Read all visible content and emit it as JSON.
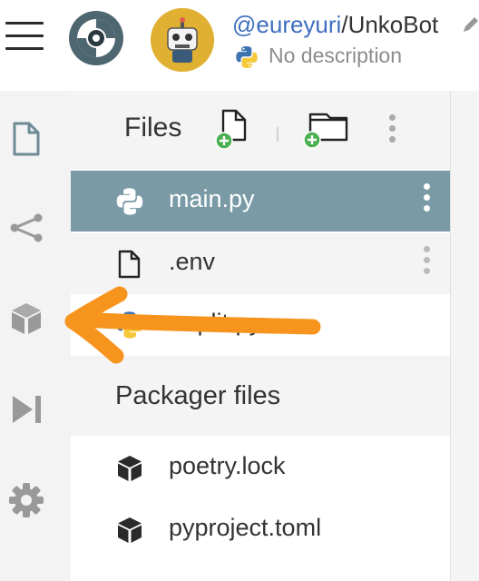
{
  "header": {
    "owner": "@eureyuri",
    "separator": "/",
    "repo": "UnkoBot",
    "description": "No description"
  },
  "sidebar": {
    "items": [
      {
        "name": "files",
        "icon": "file-icon"
      },
      {
        "name": "version-control",
        "icon": "share-nodes-icon"
      },
      {
        "name": "packages",
        "icon": "cube-icon"
      },
      {
        "name": "debugger",
        "icon": "play-step-icon"
      },
      {
        "name": "settings",
        "icon": "gear-icon"
      }
    ]
  },
  "files_panel": {
    "title": "Files",
    "files": [
      {
        "name": "main.py",
        "icon": "python-icon",
        "selected": true
      },
      {
        "name": ".env",
        "icon": "file-icon",
        "selected": false
      },
      {
        "name": ".replit.py",
        "icon": "python-icon",
        "selected": false
      }
    ],
    "packager_title": "Packager files",
    "packager_files": [
      {
        "name": "poetry.lock",
        "icon": "cube-icon"
      },
      {
        "name": "pyproject.toml",
        "icon": "cube-icon"
      }
    ]
  },
  "colors": {
    "selected_row": "#7a9aa6",
    "owner_link": "#3f6fbf",
    "annotation_arrow": "#f7941d",
    "add_badge": "#4caf50"
  }
}
